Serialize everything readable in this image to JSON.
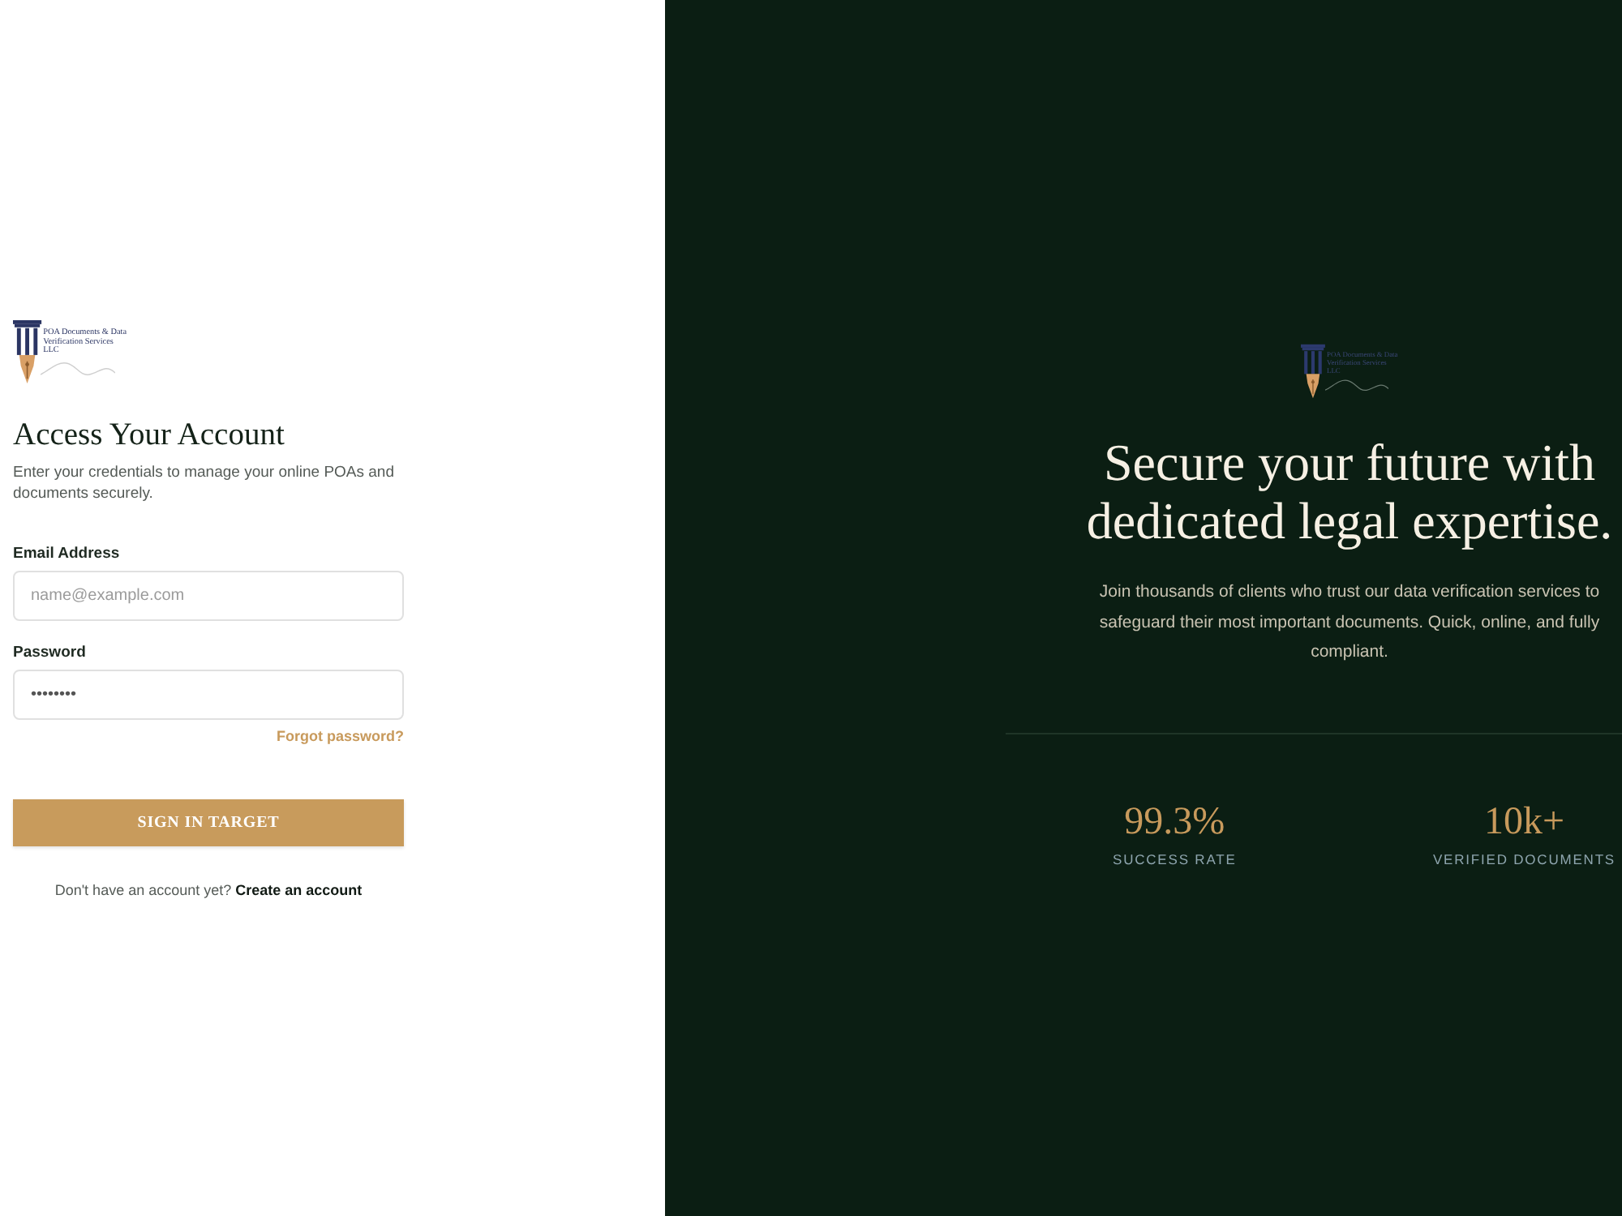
{
  "login": {
    "logo": {
      "lines": [
        "POA Documents & Data",
        "Verification Services",
        "LLC"
      ]
    },
    "title": "Access Your Account",
    "subtitle": "Enter your credentials to manage your online POAs and documents securely.",
    "fields": [
      {
        "label": "Email Address",
        "placeholder": "name@example.com"
      },
      {
        "label": "Password",
        "value": "••••••••"
      }
    ],
    "forgot_link": "Forgot password?",
    "submit_button": "SIGN IN TARGET",
    "signup_prompt": "Don't have an account yet?",
    "signup_link": "Create an account"
  },
  "promo": {
    "logo": {
      "lines": [
        "POA Documents & Data",
        "Verification Services",
        "LLC"
      ]
    },
    "headline": "Secure your future with dedicated legal expertise.",
    "description": "Join thousands of clients who trust our data verification services to safeguard their most important documents. Quick, online, and fully compliant.",
    "stats": [
      {
        "value": "99.3%",
        "label": "SUCCESS RATE"
      },
      {
        "value": "10k+",
        "label": "VERIFIED DOCUMENTS"
      }
    ]
  }
}
